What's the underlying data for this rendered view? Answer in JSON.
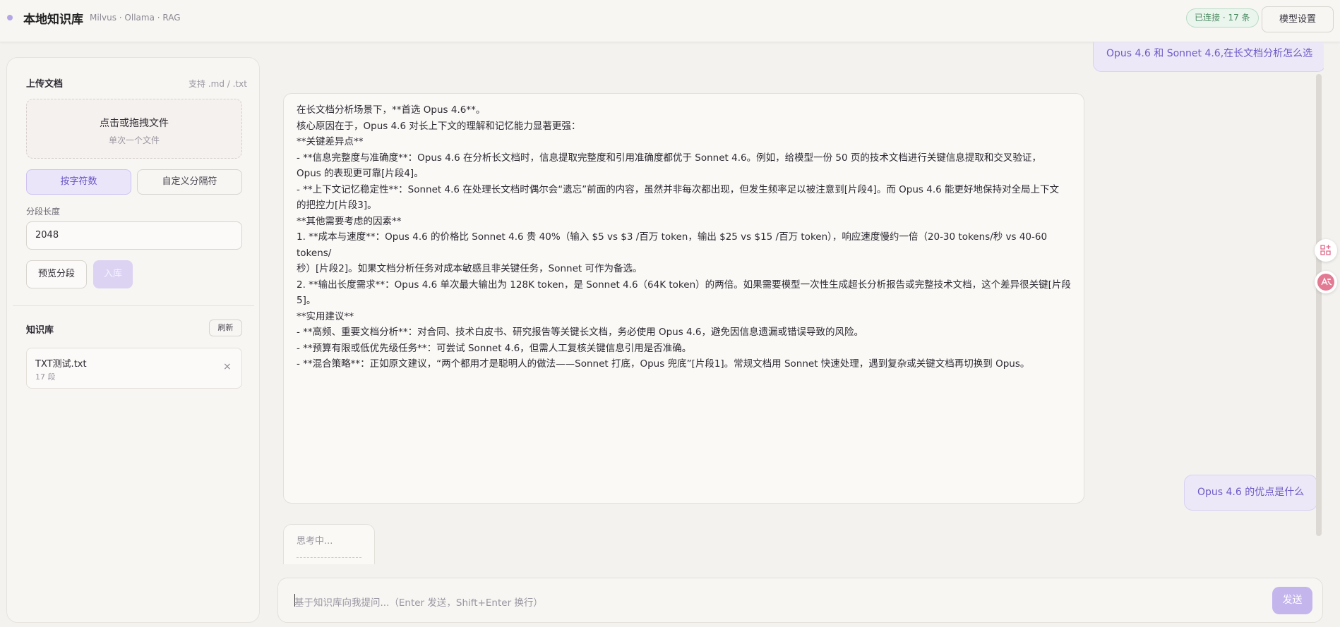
{
  "header": {
    "title": "本地知识库",
    "subtitle": "Milvus · Ollama · RAG",
    "status_badge": "已连接 · 17 条",
    "model_settings": "模型设置"
  },
  "upload": {
    "title": "上传文档",
    "supported": "支持 .md / .txt",
    "dropzone_main": "点击或拖拽文件",
    "dropzone_sub": "单次一个文件",
    "split_by_chars": "按字符数",
    "split_by_custom": "自定义分隔符",
    "segment_length_label": "分段长度",
    "segment_length_value": "2048",
    "preview_button": "预览分段",
    "import_button": "入库"
  },
  "knowledge_base": {
    "title": "知识库",
    "refresh": "刷新",
    "items": [
      {
        "name": "TXT测试.txt",
        "count": "17 段"
      }
    ]
  },
  "chat": {
    "user_message_1": "Opus 4.6 和 Sonnet 4.6,在长文档分析怎么选",
    "assistant_lines": [
      "在长文档分析场景下，**首选 Opus 4.6**。",
      "",
      "核心原因在于，Opus 4.6 对长上下文的理解和记忆能力显著更强：",
      "",
      "**关键差异点**",
      "- **信息完整度与准确度**：Opus 4.6 在分析长文档时，信息提取完整度和引用准确度都优于 Sonnet 4.6。例如，给模型一份 50 页的技术文档进行关键信息提取和交叉验证，",
      "Opus 的表现更可靠[片段4]。",
      "- **上下文记忆稳定性**：Sonnet 4.6 在处理长文档时偶尔会“遗忘”前面的内容，虽然并非每次都出现，但发生频率足以被注意到[片段4]。而 Opus 4.6 能更好地保持对全局上下文",
      "的把控力[片段3]。",
      "",
      "**其他需要考虑的因素**",
      "",
      "1. **成本与速度**：Opus 4.6 的价格比 Sonnet 4.6 贵 40%（输入 $5 vs $3 /百万 token，输出 $25 vs $15 /百万 token），响应速度慢约一倍（20-30 tokens/秒 vs 40-60 tokens/",
      "秒）[片段2]。如果文档分析任务对成本敏感且非关键任务，Sonnet 可作为备选。",
      "",
      "2. **输出长度需求**：Opus 4.6 单次最大输出为 128K token，是 Sonnet 4.6（64K token）的两倍。如果需要模型一次性生成超长分析报告或完整技术文档，这个差异很关键[片段",
      "5]。",
      "",
      "**实用建议**",
      "- **高频、重要文档分析**：对合同、技术白皮书、研究报告等关键长文档，务必使用 Opus 4.6，避免因信息遗漏或错误导致的风险。",
      "- **预算有限或低优先级任务**：可尝试 Sonnet 4.6，但需人工复核关键信息引用是否准确。",
      "- **混合策略**：正如原文建议，“两个都用才是聪明人的做法——Sonnet 打底，Opus 兜底”[片段1]。常规文档用 Sonnet 快速处理，遇到复杂或关键文档再切换到 Opus。"
    ],
    "user_message_2": "Opus 4.6 的优点是什么",
    "thinking": "思考中...",
    "input_placeholder": "基于知识库向我提问...（Enter 发送，Shift+Enter 换行）",
    "send_button": "发送"
  }
}
